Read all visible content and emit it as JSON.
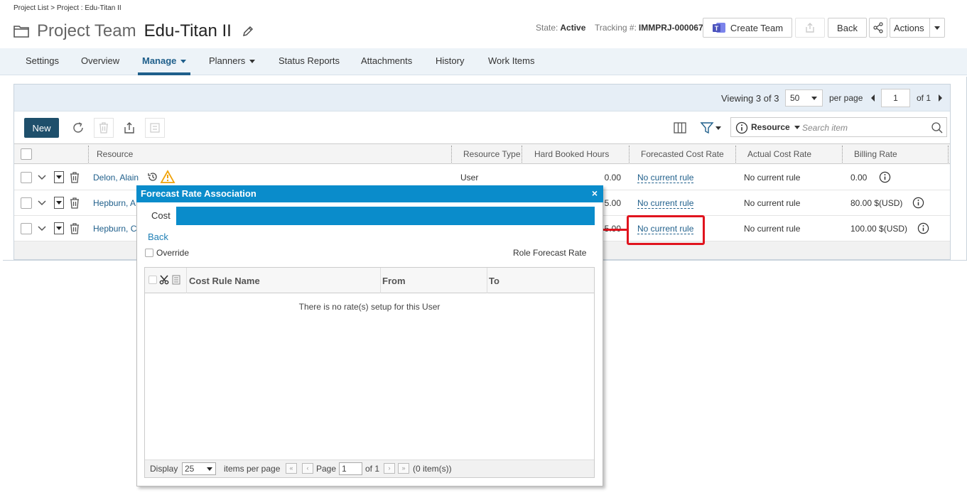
{
  "breadcrumb": "Project List > Project : Edu-Titan II",
  "header": {
    "title_prefix": "Project Team",
    "title_name": "Edu-Titan II",
    "state_label": "State:",
    "state_value": "Active",
    "tracking_label": "Tracking #:",
    "tracking_value": "IMMPRJ-000067",
    "create_team": "Create Team",
    "back": "Back",
    "actions": "Actions"
  },
  "tabs": [
    {
      "label": "Settings"
    },
    {
      "label": "Overview"
    },
    {
      "label": "Manage"
    },
    {
      "label": "Planners"
    },
    {
      "label": "Status Reports"
    },
    {
      "label": "Attachments"
    },
    {
      "label": "History"
    },
    {
      "label": "Work Items"
    }
  ],
  "pager": {
    "viewing": "Viewing",
    "range": "3 of 3",
    "per_page_value": "50",
    "per_page_label": "per page",
    "page": "1",
    "of": "of 1"
  },
  "toolbar": {
    "new": "New",
    "search_field": "Resource",
    "search_placeholder": "Search item"
  },
  "grid": {
    "columns": [
      "Resource",
      "Resource Type",
      "Hard Booked Hours",
      "Forecasted Cost Rate",
      "Actual Cost Rate",
      "Billing Rate"
    ],
    "rows": [
      {
        "resource": "Delon, Alain",
        "type": "User",
        "hours": "0.00",
        "forecast": "No current rule",
        "actual": "No current rule",
        "billing": "0.00"
      },
      {
        "resource": "Hepburn, A",
        "type": "",
        "hours": "5.00",
        "forecast": "No current rule",
        "actual": "No current rule",
        "billing": "80.00 $(USD)"
      },
      {
        "resource": "Hepburn, C",
        "type": "",
        "hours": "5.00",
        "forecast": "No current rule",
        "actual": "No current rule",
        "billing": "100.00 $(USD)"
      }
    ]
  },
  "modal": {
    "title": "Forecast Rate Association",
    "close": "×",
    "cost_tab": "Cost",
    "back": "Back",
    "override": "Override",
    "role_forecast_rate": "Role Forecast Rate",
    "columns": [
      "Cost Rule Name",
      "From",
      "To"
    ],
    "empty_message": "There is no rate(s) setup for this User",
    "footer": {
      "display": "Display",
      "display_value": "25",
      "items_per_page": "items per page",
      "page_label": "Page",
      "page_value": "1",
      "of": "of 1",
      "count": "(0 item(s))"
    }
  },
  "colors": {
    "accent_blue": "#0a8ccb",
    "nav_blue": "#1f5f8b",
    "new_button": "#1e4f6b",
    "highlight_red": "#e0141e",
    "warning": "#f0a30a"
  }
}
